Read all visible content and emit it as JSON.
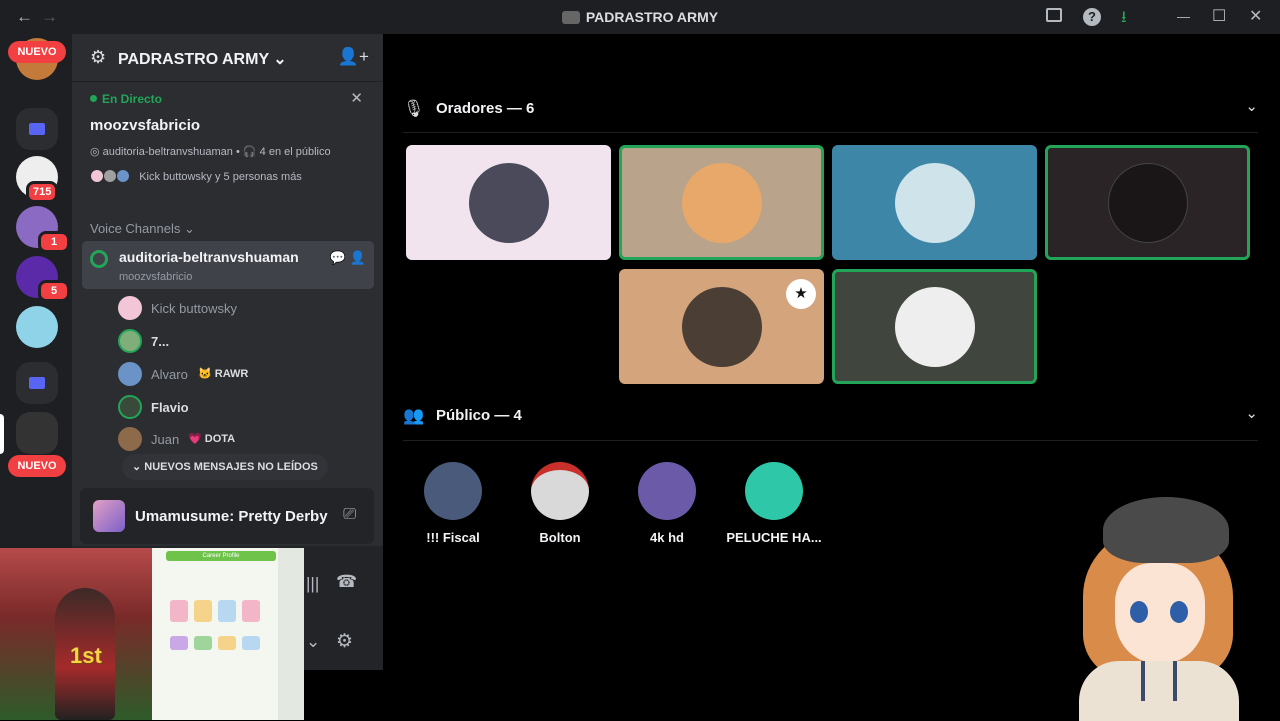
{
  "titlebar": {
    "back": "←",
    "forward": "→",
    "title": "PADRASTRO ARMY",
    "inbox_icon": "inbox-icon",
    "help": "?",
    "download": "⭳",
    "minimize": "—",
    "maximize": "☐",
    "close": "✕"
  },
  "guilds": {
    "nuevo_top": "NUEVO",
    "nuevo_bottom": "NUEVO",
    "badges": [
      "715",
      "1",
      "5"
    ]
  },
  "server": {
    "name": "PADRASTRO ARMY",
    "chevron": "⌄",
    "live_label": "En Directo",
    "stage_title": "moozvsfabricio",
    "stage_channel": "auditoria-beltranvshuaman",
    "stage_audience": "4 en el público",
    "stage_people": "Kick buttowsky y 5 personas más",
    "category": "Voice Channels ⌄",
    "voice_channel": {
      "name": "auditoria-beltranvshuaman",
      "topic": "moozvsfabricio"
    },
    "members": [
      {
        "name": "Kick buttowsky",
        "color": "#f3c6d7"
      },
      {
        "name": "7...",
        "color": "#7fae7a"
      },
      {
        "name": "Alvaro",
        "color": "#6b93c7",
        "tag": "RAWR",
        "tag_icon": "🐱"
      },
      {
        "name": "Flavio",
        "color": "#3a4a3a"
      },
      {
        "name": "Juan",
        "color": "#8c6a4a",
        "tag": "DOTA",
        "tag_icon": "💗"
      }
    ],
    "new_messages": "NUEVOS MENSAJES NO LEÍDOS"
  },
  "activity": {
    "name": "Umamusume: Pretty Derby"
  },
  "overlay": {
    "first_place": "1st",
    "panel_header": "Career Profile"
  },
  "stage": {
    "speakers_title": "Oradores — 6",
    "audience_title": "Público — 4",
    "speakers": [
      {
        "bg": "#f1e4ee",
        "avatar": "#4a4a5a",
        "speaking": false
      },
      {
        "bg": "#b9a38a",
        "avatar": "#e7a86a",
        "speaking": true
      },
      {
        "bg": "#3d86a8",
        "avatar": "#cfe3ea",
        "speaking": false
      },
      {
        "bg": "#2a2426",
        "avatar": "#1a1516",
        "speaking": true
      },
      {
        "bg": "#d4a47c",
        "avatar": "#4a3e35",
        "speaking": false,
        "moderator": true
      },
      {
        "bg": "#40453e",
        "avatar": "#eeeeee",
        "speaking": true
      }
    ],
    "audience": [
      {
        "name": "!!! Fiscal",
        "color": "#4a5a7a"
      },
      {
        "name": "Bolton",
        "color": "#d9d9d9"
      },
      {
        "name": "4k hd",
        "color": "#6a5aa8"
      },
      {
        "name": "PELUCHE HA...",
        "color": "#2ec8a8"
      }
    ]
  }
}
